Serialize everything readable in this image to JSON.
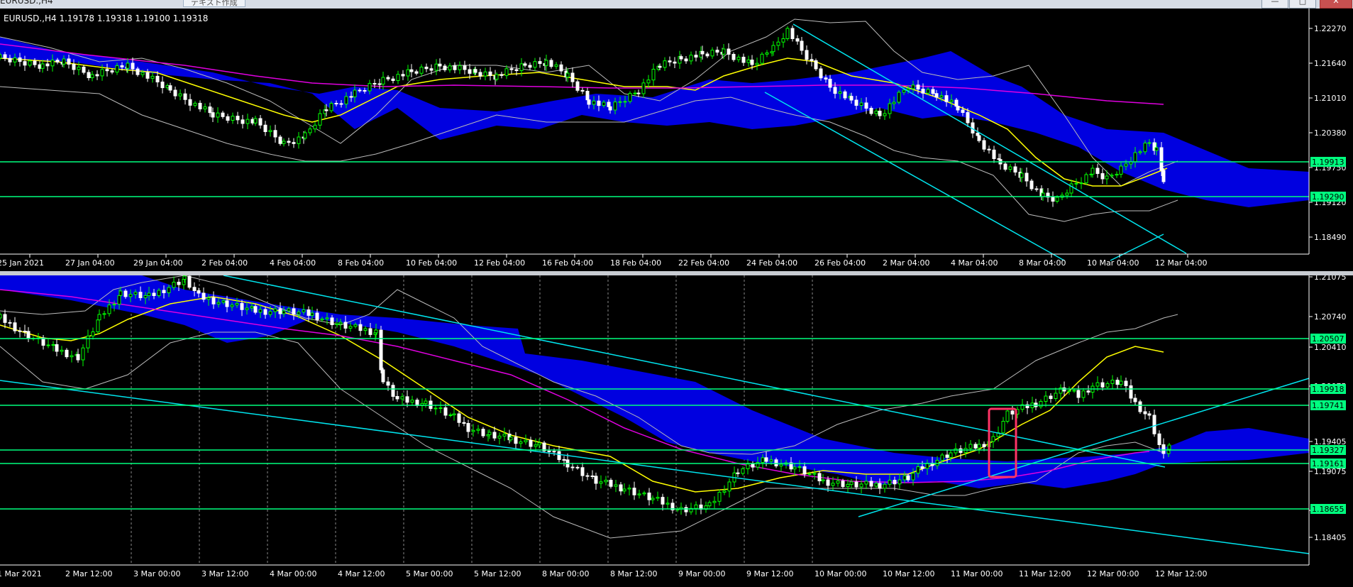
{
  "window": {
    "title": "EURUSD.,H4",
    "tab_label": "テキスト作成",
    "min_label": "—",
    "max_label": "□",
    "close_label": "✕"
  },
  "top_chart": {
    "header": "EURUSD.,H4  1.19178 1.19318 1.19100 1.19318",
    "price_ticks": [
      "1.22270",
      "1.21640",
      "1.21010",
      "1.20380",
      "1.19750",
      "1.19120",
      "1.18490"
    ],
    "level_labels": [
      "1.19913",
      "1.19290"
    ],
    "time_labels": [
      "25 Jan 2021",
      "27 Jan 04:00",
      "29 Jan 04:00",
      "2 Feb 04:00",
      "4 Feb 04:00",
      "8 Feb 04:00",
      "10 Feb 04:00",
      "12 Feb 04:00",
      "16 Feb 04:00",
      "18 Feb 04:00",
      "22 Feb 04:00",
      "24 Feb 04:00",
      "26 Feb 04:00",
      "2 Mar 04:00",
      "4 Mar 04:00",
      "8 Mar 04:00",
      "10 Mar 04:00",
      "12 Mar 04:00"
    ]
  },
  "bottom_chart": {
    "price_ticks": [
      "1.21075",
      "1.20740",
      "1.20410",
      "1.20075",
      "1.19405",
      "1.19075",
      "1.18740",
      "1.18405"
    ],
    "level_labels": [
      "1.20507",
      "1.19918",
      "1.19741",
      "1.19327",
      "1.19161",
      "1.18655"
    ],
    "time_labels": [
      "1 Mar 2021",
      "2 Mar 12:00",
      "3 Mar 00:00",
      "3 Mar 12:00",
      "4 Mar 00:00",
      "4 Mar 12:00",
      "5 Mar 00:00",
      "5 Mar 12:00",
      "8 Mar 00:00",
      "8 Mar 12:00",
      "9 Mar 00:00",
      "9 Mar 12:00",
      "10 Mar 00:00",
      "10 Mar 12:00",
      "11 Mar 00:00",
      "11 Mar 12:00",
      "12 Mar 00:00",
      "12 Mar 12:00"
    ]
  },
  "colors": {
    "background": "#000000",
    "candle": "#ffffff",
    "candle_bull": "#00ff00",
    "ma_short": "#ffff00",
    "ma_long": "#ff00ff",
    "bollinger": "#c0c0c0",
    "ichimoku_cloud": "#0000e0",
    "trendline": "#00ffff",
    "horizontal_level": "#00ff7f",
    "highlight_box": "#ff3366",
    "axis_text": "#ffffff",
    "grid": "#ffffff"
  }
}
